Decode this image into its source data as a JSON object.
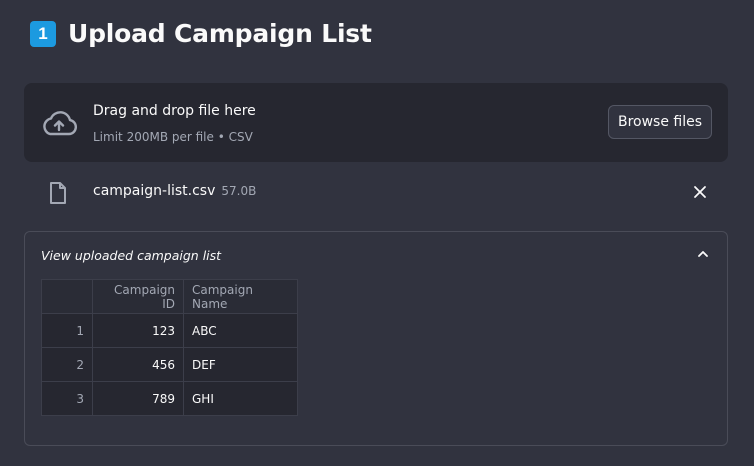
{
  "header": {
    "step_number": "1",
    "title": "Upload Campaign List"
  },
  "uploader": {
    "drag_text": "Drag and drop file here",
    "limit_text": "Limit 200MB per file • CSV",
    "browse_label": "Browse files",
    "icon": "cloud-upload-icon"
  },
  "file": {
    "name": "campaign-list.csv",
    "size": "57.0B",
    "icon": "file-icon",
    "remove_icon": "close-icon"
  },
  "expander": {
    "label": "View uploaded campaign list",
    "expanded": true,
    "icon": "chevron-up-icon"
  },
  "table": {
    "columns": [
      "",
      "Campaign ID",
      "Campaign Name"
    ],
    "rows": [
      {
        "index": "1",
        "campaign_id": "123",
        "campaign_name": "ABC"
      },
      {
        "index": "2",
        "campaign_id": "456",
        "campaign_name": "DEF"
      },
      {
        "index": "3",
        "campaign_id": "789",
        "campaign_name": "GHI"
      }
    ]
  },
  "colors": {
    "background": "#31333f",
    "dropzone": "#262730",
    "accent": "#1c9ae0",
    "text": "#fafafa",
    "muted": "#a3a8b4"
  }
}
